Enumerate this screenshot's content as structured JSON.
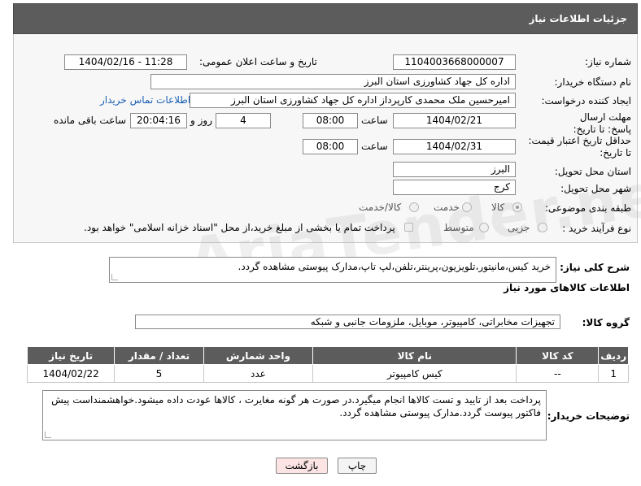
{
  "header": {
    "title": "جزئیات اطلاعات نیاز"
  },
  "form": {
    "need_number": {
      "label": "شماره نیاز:",
      "value": "1104003668000007"
    },
    "announce_datetime": {
      "label": "تاریخ و ساعت اعلان عمومی:",
      "value": "1404/02/16 - 11:28"
    },
    "buyer_org": {
      "label": "نام دستگاه خریدار:",
      "value": "اداره کل جهاد کشاورزی استان البرز"
    },
    "requester": {
      "label": "ایجاد کننده درخواست:",
      "value": "امیرحسین ملک محمدی کارپرداز اداره کل جهاد کشاورزی استان البرز",
      "contact_link": "اطلاعات تماس خریدار"
    },
    "reply_deadline": {
      "label": "مهلت ارسال پاسخ: تا تاریخ:",
      "date": "1404/02/21",
      "time_label": "ساعت",
      "time": "08:00",
      "days": "4",
      "days_label": "روز و",
      "remaining": "20:04:16",
      "remaining_label": "ساعت باقی مانده"
    },
    "price_validity": {
      "label": "حداقل تاریخ اعتبار قیمت: تا تاریخ:",
      "date": "1404/02/31",
      "time_label": "ساعت",
      "time": "08:00"
    },
    "delivery_province": {
      "label": "استان محل تحویل:",
      "value": "البرز"
    },
    "delivery_city": {
      "label": "شهر محل تحویل:",
      "value": "کرج"
    },
    "category": {
      "label": "طبقه بندی موضوعی:",
      "options": [
        "کالا",
        "خدمت",
        "کالا/خدمت"
      ],
      "selected": "کالا"
    },
    "process_type": {
      "label": "نوع فرآیند خرید :",
      "options": [
        "جزیی",
        "متوسط"
      ],
      "payment_note": "پرداخت تمام یا بخشی از مبلغ خرید،از محل \"اسناد خزانه اسلامی\" خواهد بود."
    }
  },
  "description": {
    "label": "شرح کلی نیاز:",
    "value": "خرید کیس،مانیتور،تلویزیون،پرینتر،تلفن،لپ تاپ،مدارک پیوستی مشاهده گردد."
  },
  "goods_section": {
    "title": "اطلاعات کالاهای مورد نیاز",
    "group_label": "گروه کالا:",
    "group_value": "تجهیزات مخابراتی، کامپیوتر، موبایل، ملزومات جانبی و شبکه"
  },
  "table": {
    "headers": [
      "ردیف",
      "کد کالا",
      "نام کالا",
      "واحد شمارش",
      "تعداد / مقدار",
      "تاریخ نیاز"
    ],
    "rows": [
      [
        "1",
        "--",
        "کیس کامپیوتر",
        "عدد",
        "5",
        "1404/02/22"
      ]
    ]
  },
  "buyer_notes": {
    "label": "توضیحات خریدار:",
    "value": "پرداخت بعد از تایید و تست کالاها انجام میگیرد.در صورت هر گونه مغایرت ، کالاها عودت داده میشود.خواهشمنداست پیش فاکتور پیوست گردد.مدارک پیوستی مشاهده گردد."
  },
  "buttons": {
    "print": "چاپ",
    "back": "بازگشت"
  },
  "watermark": "AriaTender.net"
}
